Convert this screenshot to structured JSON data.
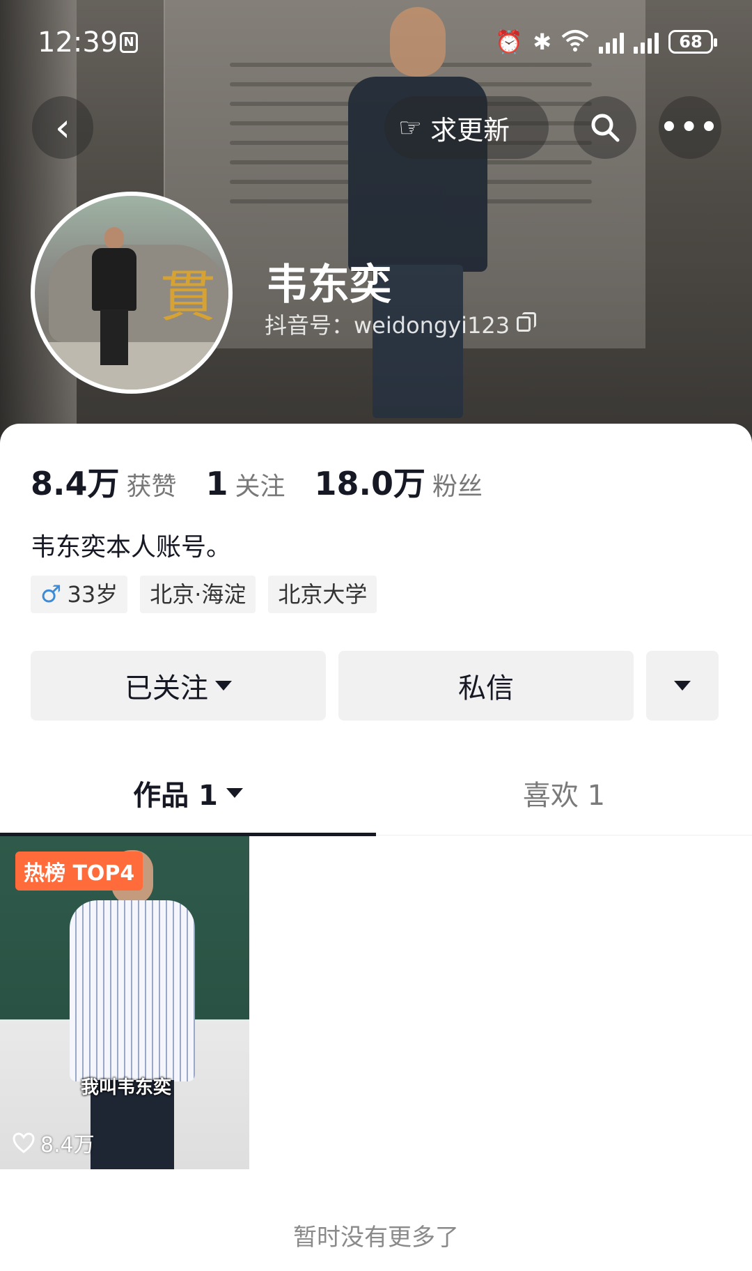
{
  "status_bar": {
    "time": "12:39",
    "nfc": "N",
    "battery": "68"
  },
  "header": {
    "request_update_label": "求更新",
    "username": "韦东奕",
    "douyin_id": "抖音号：weidongyi123"
  },
  "stats": [
    {
      "value": "8.4万",
      "label": "获赞"
    },
    {
      "value": "1",
      "label": "关注"
    },
    {
      "value": "18.0万",
      "label": "粉丝"
    }
  ],
  "bio": "韦东奕本人账号。",
  "tags": {
    "age": "33岁",
    "location": "北京·海淀",
    "school": "北京大学"
  },
  "actions": {
    "followed_label": "已关注",
    "message_label": "私信"
  },
  "tabs": {
    "works_label": "作品 1",
    "likes_label": "喜欢 1"
  },
  "video": {
    "badge": "热榜 TOP4",
    "caption": "我叫韦东奕",
    "likes": "8.4万"
  },
  "footer": {
    "no_more_text": "暂时没有更多了"
  },
  "colors": {
    "hot_badge": "#ff6b3b",
    "male_icon": "#3d8bd6",
    "primary_text": "#161823"
  }
}
